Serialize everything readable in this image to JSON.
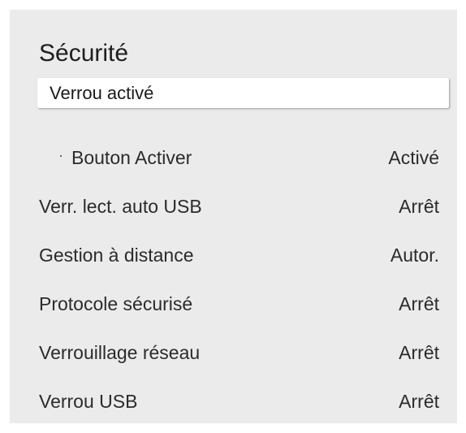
{
  "panel": {
    "title": "Sécurité"
  },
  "items": [
    {
      "label": "Verrou activé",
      "value": ""
    },
    {
      "label": "Bouton Activer",
      "value": "Activé"
    },
    {
      "label": "Verr. lect. auto USB",
      "value": "Arrêt"
    },
    {
      "label": "Gestion à distance",
      "value": "Autor."
    },
    {
      "label": "Protocole sécurisé",
      "value": "Arrêt"
    },
    {
      "label": "Verrouillage réseau",
      "value": "Arrêt"
    },
    {
      "label": "Verrou USB",
      "value": "Arrêt"
    }
  ]
}
